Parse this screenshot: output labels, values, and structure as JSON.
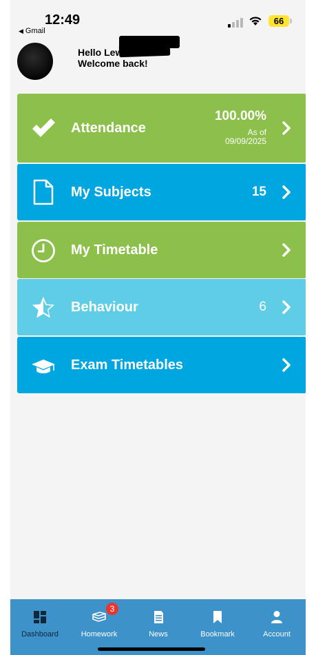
{
  "status_bar": {
    "time": "12:49",
    "back_app": "Gmail",
    "battery": "66"
  },
  "header": {
    "hello": "Hello Lew",
    "welcome": "Welcome back!"
  },
  "cards": {
    "attendance": {
      "label": "Attendance",
      "percent": "100.00%",
      "as_of": "As of",
      "date": "09/09/2025",
      "icon": "checkmark-icon",
      "color": "#8cc04a"
    },
    "subjects": {
      "label": "My Subjects",
      "count": "15",
      "icon": "document-icon",
      "color": "#00a6df"
    },
    "timetable": {
      "label": "My Timetable",
      "icon": "clock-icon",
      "color": "#8cc04a"
    },
    "behaviour": {
      "label": "Behaviour",
      "count": "6",
      "icon": "star-icon",
      "color": "#5fcde6"
    },
    "exams": {
      "label": "Exam Timetables",
      "icon": "graduation-cap-icon",
      "color": "#00a6df"
    }
  },
  "bottom_nav": {
    "dashboard": "Dashboard",
    "homework": "Homework",
    "homework_badge": "3",
    "news": "News",
    "bookmark": "Bookmark",
    "account": "Account",
    "background": "#3d92c9"
  }
}
